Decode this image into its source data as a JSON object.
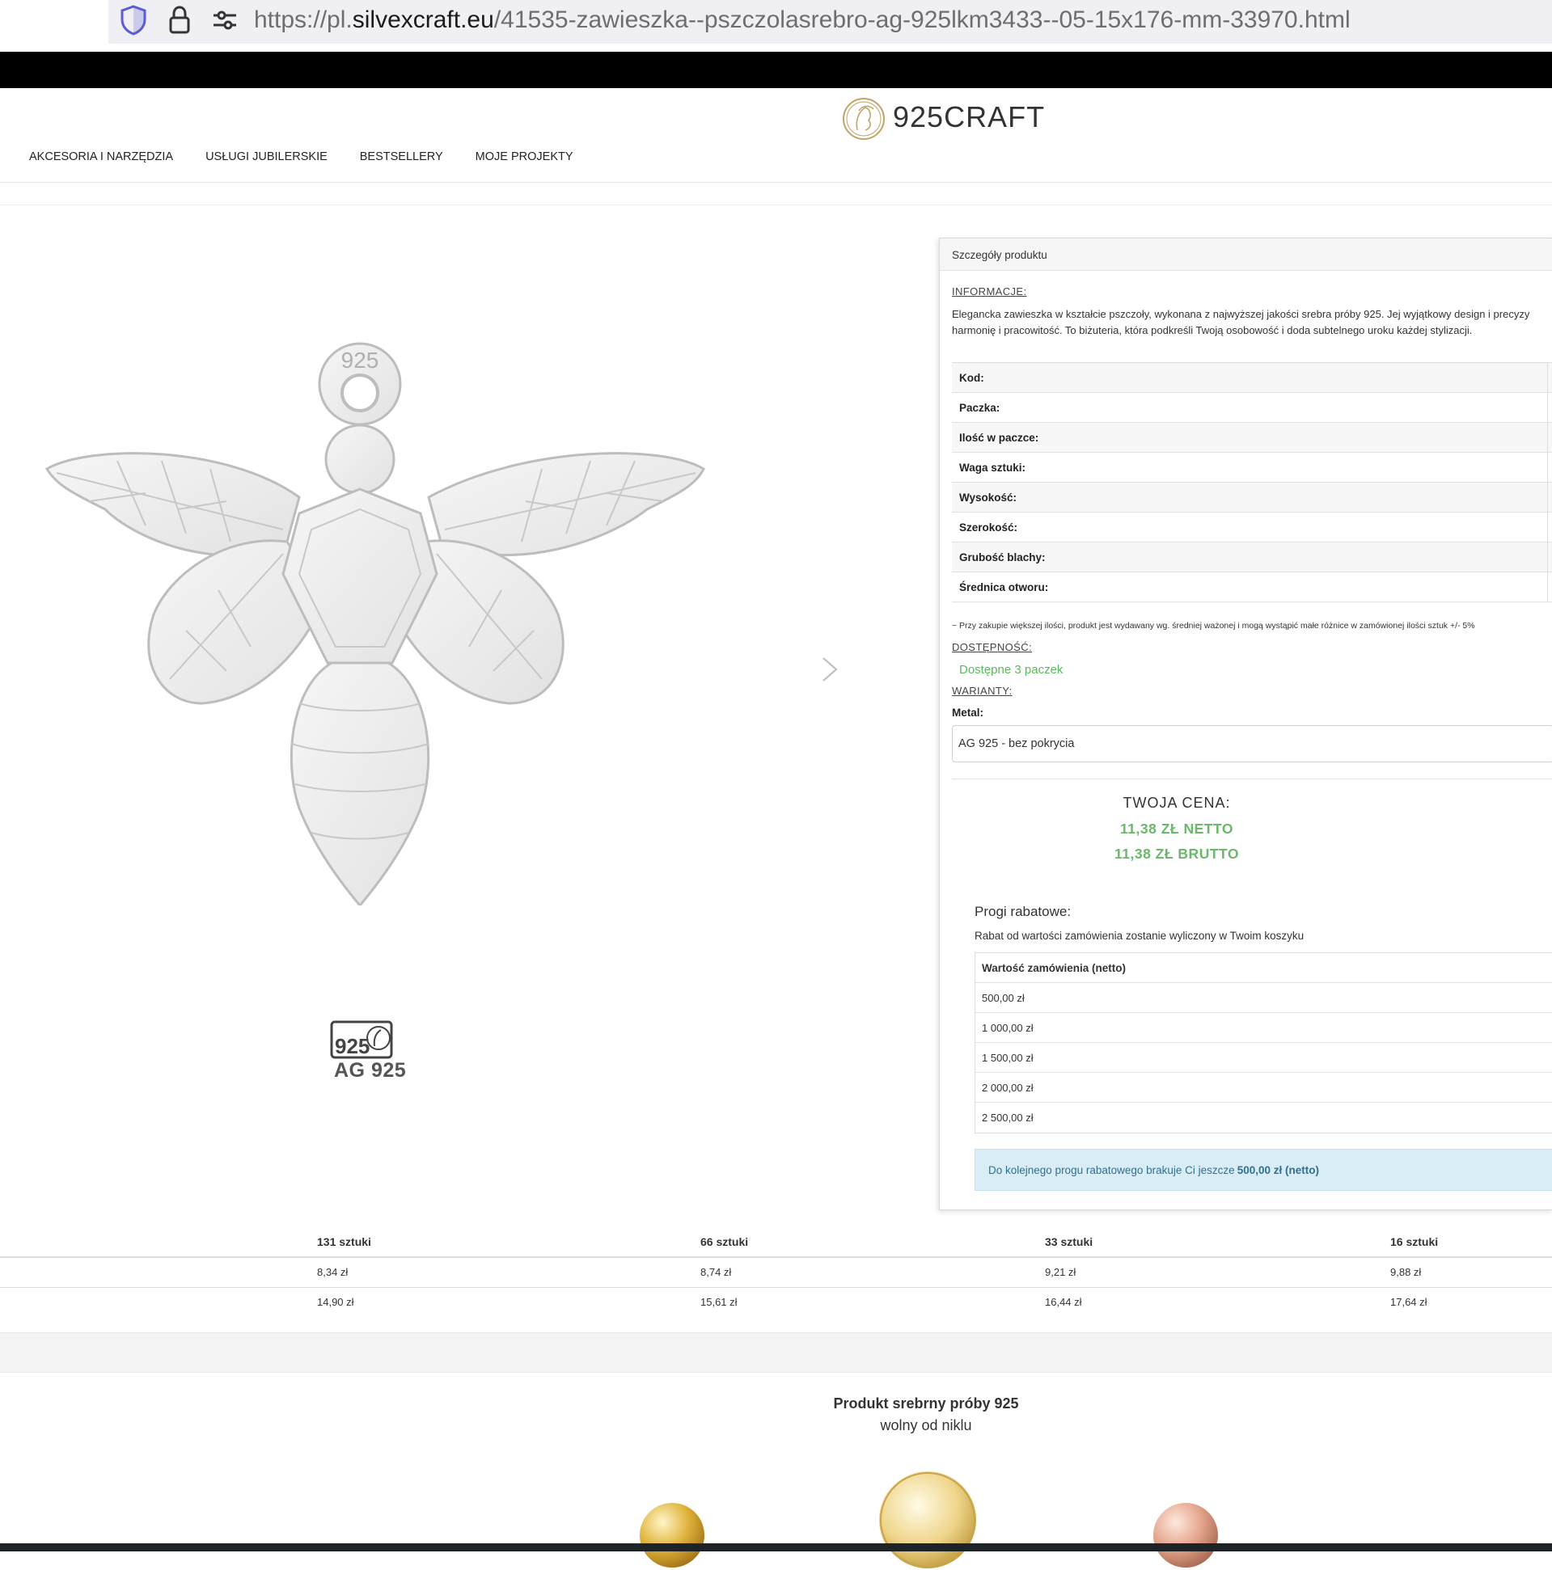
{
  "browser": {
    "url_prefix": "https://pl.",
    "url_domain": "silvexcraft.eu",
    "url_path": "/41535-zawieszka--pszczolasrebro-ag-925lkm3433--05-15x176-mm-33970.html",
    "icons": [
      "shield-icon",
      "lock-icon",
      "page-settings-icon"
    ]
  },
  "header": {
    "logo_text": "925CRAFT",
    "nav": [
      "AKCESORIA I NARZĘDZIA",
      "USŁUGI JUBILERSKIE",
      "BESTSELLERY",
      "MOJE PROJEKTY"
    ]
  },
  "gallery": {
    "hallmark_text": "AG 925",
    "hallmark_mark": "925",
    "pendant_stamp": "925",
    "next_icon": "chevron-right-icon"
  },
  "details": {
    "panel_title": "Szczegóły produktu",
    "info_label": "INFORMACJE:",
    "info_text_1": "Elegancka zawieszka w kształcie pszczoły, wykonana z najwyższej jakości srebra próby 925. Jej wyjątkowy design i precyzy",
    "info_text_2": "harmonię i pracowitość. To biżuteria, która podkreśli Twoją osobowość i doda subtelnego uroku każdej stylizacji.",
    "specs": [
      "Kod:",
      "Paczka:",
      "Ilość w paczce:",
      "Waga sztuki:",
      "Wysokość:",
      "Szerokość:",
      "Grubość blachy:",
      "Średnica otworu:"
    ],
    "note": "~ Przy zakupie większej ilości, produkt jest wydawany wg. średniej ważonej i mogą wystąpić małe różnice w zamówionej ilości sztuk +/- 5%",
    "availability_label": "DOSTĘPNOŚĆ:",
    "availability": "Dostępne 3 paczek",
    "variants_label": "WARIANTY:",
    "metal_label": "Metal:",
    "metal_value": "AG 925 - bez pokrycia",
    "price_label": "TWOJA CENA:",
    "price_net": "11,38 ZŁ NETTO",
    "price_gross": "11,38 ZŁ BRUTTO",
    "discount_title": "Progi rabatowe:",
    "discount_sub": "Rabat od wartości zamówienia zostanie wyliczony w Twoim koszyku",
    "discount_header": "Wartość zamówienia (netto)",
    "discount_rows": [
      "500,00 zł",
      "1 000,00 zł",
      "1 500,00 zł",
      "2 000,00 zł",
      "2 500,00 zł"
    ],
    "promo_text": "Do kolejnego progu rabatowego brakuje Ci jeszcze",
    "promo_amount": "500,00 zł (netto)"
  },
  "quantity_table": {
    "headers": [
      "131 sztuki",
      "66 sztuki",
      "33 sztuki",
      "16 sztuki"
    ],
    "row1": [
      "8,34 zł",
      "8,74 zł",
      "9,21 zł",
      "9,88 zł"
    ],
    "row2": [
      "14,90 zł",
      "15,61 zł",
      "16,44 zł",
      "17,64 zł"
    ]
  },
  "silver": {
    "title": "Produkt srebrny próby 925",
    "subtitle": "wolny od niklu"
  },
  "colors": {
    "green": "#5cb85c",
    "info_bg": "#d9edf7",
    "info_text": "#31708f"
  }
}
